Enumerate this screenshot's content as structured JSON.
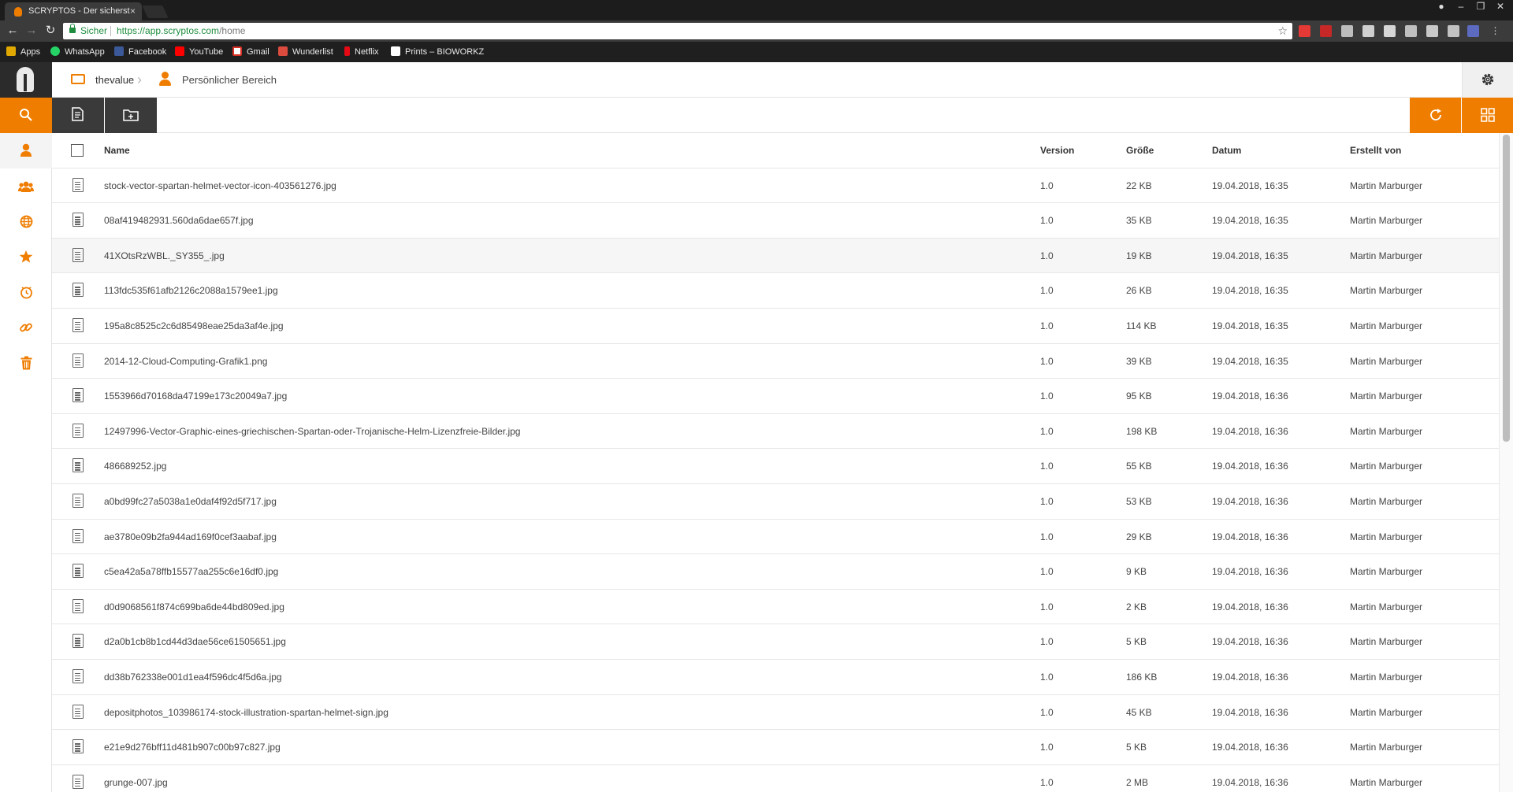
{
  "browser": {
    "tab_title": "SCRYPTOS - Der sicherst",
    "tab_close": "×",
    "secure_label": "Sicher",
    "url_host": "https://app.scryptos.com",
    "url_path": "/home",
    "bookmarks": [
      "Apps",
      "WhatsApp",
      "Facebook",
      "YouTube",
      "Gmail",
      "Wunderlist",
      "Netflix",
      "Prints – BIOWORKZ"
    ]
  },
  "breadcrumb": {
    "root": "thevalue",
    "current": "Persönlicher Bereich"
  },
  "columns": {
    "name": "Name",
    "version": "Version",
    "size": "Größe",
    "date": "Datum",
    "created_by": "Erstellt von"
  },
  "files": [
    {
      "name": "stock-vector-spartan-helmet-vector-icon-403561276.jpg",
      "version": "1.0",
      "size": "22 KB",
      "date": "19.04.2018, 16:35",
      "user": "Martin Marburger"
    },
    {
      "name": "08af419482931.560da6dae657f.jpg",
      "version": "1.0",
      "size": "35 KB",
      "date": "19.04.2018, 16:35",
      "user": "Martin Marburger"
    },
    {
      "name": "41XOtsRzWBL._SY355_.jpg",
      "version": "1.0",
      "size": "19 KB",
      "date": "19.04.2018, 16:35",
      "user": "Martin Marburger"
    },
    {
      "name": "113fdc535f61afb2126c2088a1579ee1.jpg",
      "version": "1.0",
      "size": "26 KB",
      "date": "19.04.2018, 16:35",
      "user": "Martin Marburger"
    },
    {
      "name": "195a8c8525c2c6d85498eae25da3af4e.jpg",
      "version": "1.0",
      "size": "114 KB",
      "date": "19.04.2018, 16:35",
      "user": "Martin Marburger"
    },
    {
      "name": "2014-12-Cloud-Computing-Grafik1.png",
      "version": "1.0",
      "size": "39 KB",
      "date": "19.04.2018, 16:35",
      "user": "Martin Marburger"
    },
    {
      "name": "1553966d70168da47199e173c20049a7.jpg",
      "version": "1.0",
      "size": "95 KB",
      "date": "19.04.2018, 16:36",
      "user": "Martin Marburger"
    },
    {
      "name": "12497996-Vector-Graphic-eines-griechischen-Spartan-oder-Trojanische-Helm-Lizenzfreie-Bilder.jpg",
      "version": "1.0",
      "size": "198 KB",
      "date": "19.04.2018, 16:36",
      "user": "Martin Marburger"
    },
    {
      "name": "486689252.jpg",
      "version": "1.0",
      "size": "55 KB",
      "date": "19.04.2018, 16:36",
      "user": "Martin Marburger"
    },
    {
      "name": "a0bd99fc27a5038a1e0daf4f92d5f717.jpg",
      "version": "1.0",
      "size": "53 KB",
      "date": "19.04.2018, 16:36",
      "user": "Martin Marburger"
    },
    {
      "name": "ae3780e09b2fa944ad169f0cef3aabaf.jpg",
      "version": "1.0",
      "size": "29 KB",
      "date": "19.04.2018, 16:36",
      "user": "Martin Marburger"
    },
    {
      "name": "c5ea42a5a78ffb15577aa255c6e16df0.jpg",
      "version": "1.0",
      "size": "9 KB",
      "date": "19.04.2018, 16:36",
      "user": "Martin Marburger"
    },
    {
      "name": "d0d9068561f874c699ba6de44bd809ed.jpg",
      "version": "1.0",
      "size": "2 KB",
      "date": "19.04.2018, 16:36",
      "user": "Martin Marburger"
    },
    {
      "name": "d2a0b1cb8b1cd44d3dae56ce61505651.jpg",
      "version": "1.0",
      "size": "5 KB",
      "date": "19.04.2018, 16:36",
      "user": "Martin Marburger"
    },
    {
      "name": "dd38b762338e001d1ea4f596dc4f5d6a.jpg",
      "version": "1.0",
      "size": "186 KB",
      "date": "19.04.2018, 16:36",
      "user": "Martin Marburger"
    },
    {
      "name": "depositphotos_103986174-stock-illustration-spartan-helmet-sign.jpg",
      "version": "1.0",
      "size": "45 KB",
      "date": "19.04.2018, 16:36",
      "user": "Martin Marburger"
    },
    {
      "name": "e21e9d276bff11d481b907c00b97c827.jpg",
      "version": "1.0",
      "size": "5 KB",
      "date": "19.04.2018, 16:36",
      "user": "Martin Marburger"
    },
    {
      "name": "grunge-007.jpg",
      "version": "1.0",
      "size": "2 MB",
      "date": "19.04.2018, 16:36",
      "user": "Martin Marburger"
    }
  ],
  "colors": {
    "accent": "#ef7d00",
    "dark": "#3a3a3a"
  },
  "icons": {
    "rail": [
      "search-icon",
      "user-icon",
      "group-icon",
      "globe-icon",
      "star-icon",
      "clock-icon",
      "link-icon",
      "trash-icon"
    ],
    "actions": [
      "new-file-icon",
      "new-folder-icon",
      "refresh-icon",
      "grid-view-icon"
    ]
  }
}
